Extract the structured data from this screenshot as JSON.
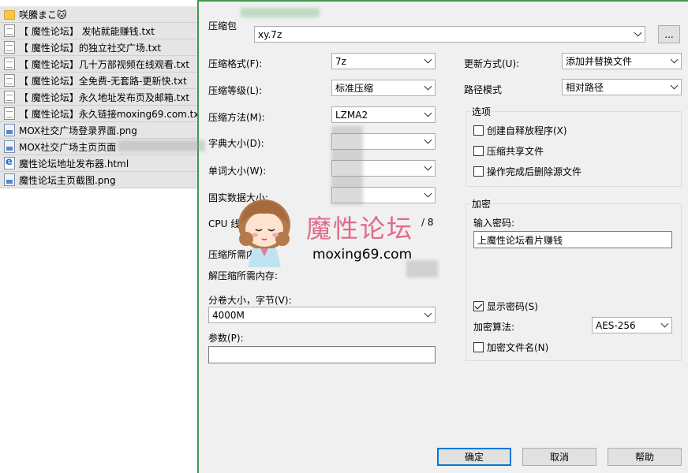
{
  "file_list": [
    {
      "name": "咲騰まこ🐱",
      "icon": "folder-icon"
    },
    {
      "name": "【 魔性论坛】 发帖就能赚钱.txt",
      "icon": "text-file-icon"
    },
    {
      "name": "【 魔性论坛】的独立社交广场.txt",
      "icon": "text-file-icon"
    },
    {
      "name": "【 魔性论坛】几十万部视频在线观看.txt",
      "icon": "text-file-icon"
    },
    {
      "name": "【 魔性论坛】全免费-无套路-更新快.txt",
      "icon": "text-file-icon"
    },
    {
      "name": "【 魔性论坛】永久地址发布页及邮箱.txt",
      "icon": "text-file-icon"
    },
    {
      "name": "【 魔性论坛】永久链接moxing69.com.txt",
      "icon": "text-file-icon"
    },
    {
      "name": "MOX社交广场登录界面.png",
      "icon": "image-file-icon"
    },
    {
      "name": "MOX社交广场主页页面",
      "icon": "image-file-icon"
    },
    {
      "name": "魔性论坛地址发布器.html",
      "icon": "html-file-icon"
    },
    {
      "name": "魔性论坛主页截图.png",
      "icon": "image-file-icon"
    }
  ],
  "dialog": {
    "archive_label": "压缩包",
    "archive_value": "xy.7z",
    "browse_label": "...",
    "format_label": "压缩格式(F):",
    "format_value": "7z",
    "level_label": "压缩等级(L):",
    "level_value": "标准压缩",
    "method_label": "压缩方法(M):",
    "method_value": "LZMA2",
    "dict_label": "字典大小(D):",
    "word_label": "单词大小(W):",
    "solid_label": "固实数据大小:",
    "cpu_label": "CPU 线程数:",
    "cpu_value": "/ 8",
    "mem_comp_label": "压缩所需内存:",
    "mem_decomp_label": "解压缩所需内存:",
    "volume_label": "分卷大小，字节(V):",
    "volume_value": "4000M",
    "params_label": "参数(P):",
    "params_value": "",
    "update_label": "更新方式(U):",
    "update_value": "添加并替换文件",
    "path_label": "路径模式",
    "path_value": "相对路径",
    "options_title": "选项",
    "opt_sfx": "创建自释放程序(X)",
    "opt_shared": "压缩共享文件",
    "opt_delete": "操作完成后删除源文件",
    "encrypt_title": "加密",
    "password_label": "输入密码:",
    "password_value": "上魔性论坛看片赚钱",
    "show_password": "显示密码(S)",
    "enc_method_label": "加密算法:",
    "enc_method_value": "AES-256",
    "encrypt_names": "加密文件名(N)",
    "ok_label": "确定",
    "cancel_label": "取消",
    "help_label": "帮助"
  },
  "watermark": {
    "title": "魔性论坛",
    "url": "moxing69.com"
  },
  "colors": {
    "accent": "#0078d7",
    "dialog_bg": "#f0f0f0",
    "watermark": "#e06a8a",
    "top_border": "#3c9a4a"
  }
}
